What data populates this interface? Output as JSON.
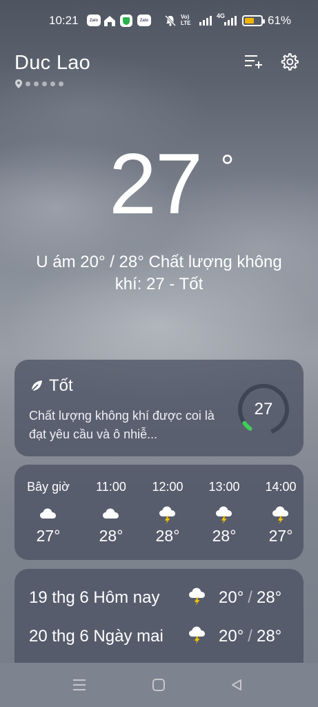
{
  "status_bar": {
    "time": "10:21",
    "zalo_label": "Zalo",
    "volte_label": "Vo) LTE",
    "network_label": "4G",
    "battery_percent": "61%",
    "battery_level": 0.61,
    "battery_color": "#f5b400"
  },
  "header": {
    "city": "Duc Lao",
    "page_count": 6,
    "current_page": 0
  },
  "current": {
    "temperature": "27",
    "degree_symbol": "°",
    "summary": "U ám  20° / 28°  Chất lượng không khí: 27 - Tốt"
  },
  "air_quality": {
    "title": "Tốt",
    "description": "Chất lượng không khí được coi là đạt yêu cầu và ô nhiễ...",
    "value": "27",
    "ring_fraction": 0.054,
    "accent": "#3ecf5a"
  },
  "hourly": [
    {
      "time": "Bây giờ",
      "icon": "cloud-icon",
      "temp": "27°"
    },
    {
      "time": "11:00",
      "icon": "cloud-icon",
      "temp": "28°"
    },
    {
      "time": "12:00",
      "icon": "thunderstorm-icon",
      "temp": "28°"
    },
    {
      "time": "13:00",
      "icon": "thunderstorm-icon",
      "temp": "28°"
    },
    {
      "time": "14:00",
      "icon": "thunderstorm-icon",
      "temp": "27°"
    }
  ],
  "daily": [
    {
      "label": "19 thg 6 Hôm nay",
      "icon": "thunderstorm-icon",
      "low": "20°",
      "high": "28°"
    },
    {
      "label": "20 thg 6 Ngày mai",
      "icon": "thunderstorm-icon",
      "low": "20°",
      "high": "28°"
    }
  ],
  "range_separator": "/"
}
